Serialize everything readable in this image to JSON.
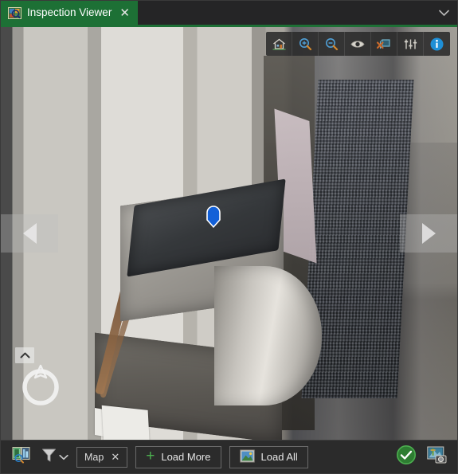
{
  "window": {
    "tab": {
      "icon": "inspection-image-icon",
      "label": "Inspection Viewer",
      "close": "✕"
    },
    "overflow_chevron": "chevron-down-icon",
    "accent_color": "#1d7035"
  },
  "image_toolbar": {
    "buttons": [
      {
        "name": "home",
        "icon": "home-icon",
        "tooltip": "Home"
      },
      {
        "name": "zoom-in",
        "icon": "zoom-in-icon",
        "tooltip": "Zoom In"
      },
      {
        "name": "zoom-out",
        "icon": "zoom-out-icon",
        "tooltip": "Zoom Out"
      },
      {
        "name": "visibility",
        "icon": "eye-icon",
        "tooltip": "Show / Hide"
      },
      {
        "name": "clear-shape",
        "icon": "delete-shape-icon",
        "tooltip": "Clear Shape"
      },
      {
        "name": "adjustments",
        "icon": "sliders-icon",
        "tooltip": "Adjustments"
      },
      {
        "name": "info",
        "icon": "info-icon",
        "tooltip": "Info"
      }
    ]
  },
  "viewer": {
    "nav_prev": {
      "icon": "arrow-left-icon"
    },
    "nav_next": {
      "icon": "arrow-right-icon"
    },
    "marker": {
      "icon": "map-marker-icon",
      "color": "#1260d8"
    },
    "compass": {
      "icon": "compass-ring-icon"
    },
    "compass_expand": {
      "icon": "chevron-up-icon"
    }
  },
  "bottom_bar": {
    "search_images": {
      "icon": "map-image-search-icon"
    },
    "filter": {
      "icon": "filter-funnel-icon",
      "chevron": "chevron-down-icon"
    },
    "chip": {
      "label": "Map",
      "close": "✕"
    },
    "load_more": {
      "icon": "plus-icon",
      "plus": "+",
      "label": "Load More"
    },
    "load_all": {
      "icon": "image-icon",
      "label": "Load All"
    },
    "confirm": {
      "icon": "check-circle-icon",
      "color": "#2e7d32"
    },
    "capture": {
      "icon": "camera-image-icon"
    }
  }
}
